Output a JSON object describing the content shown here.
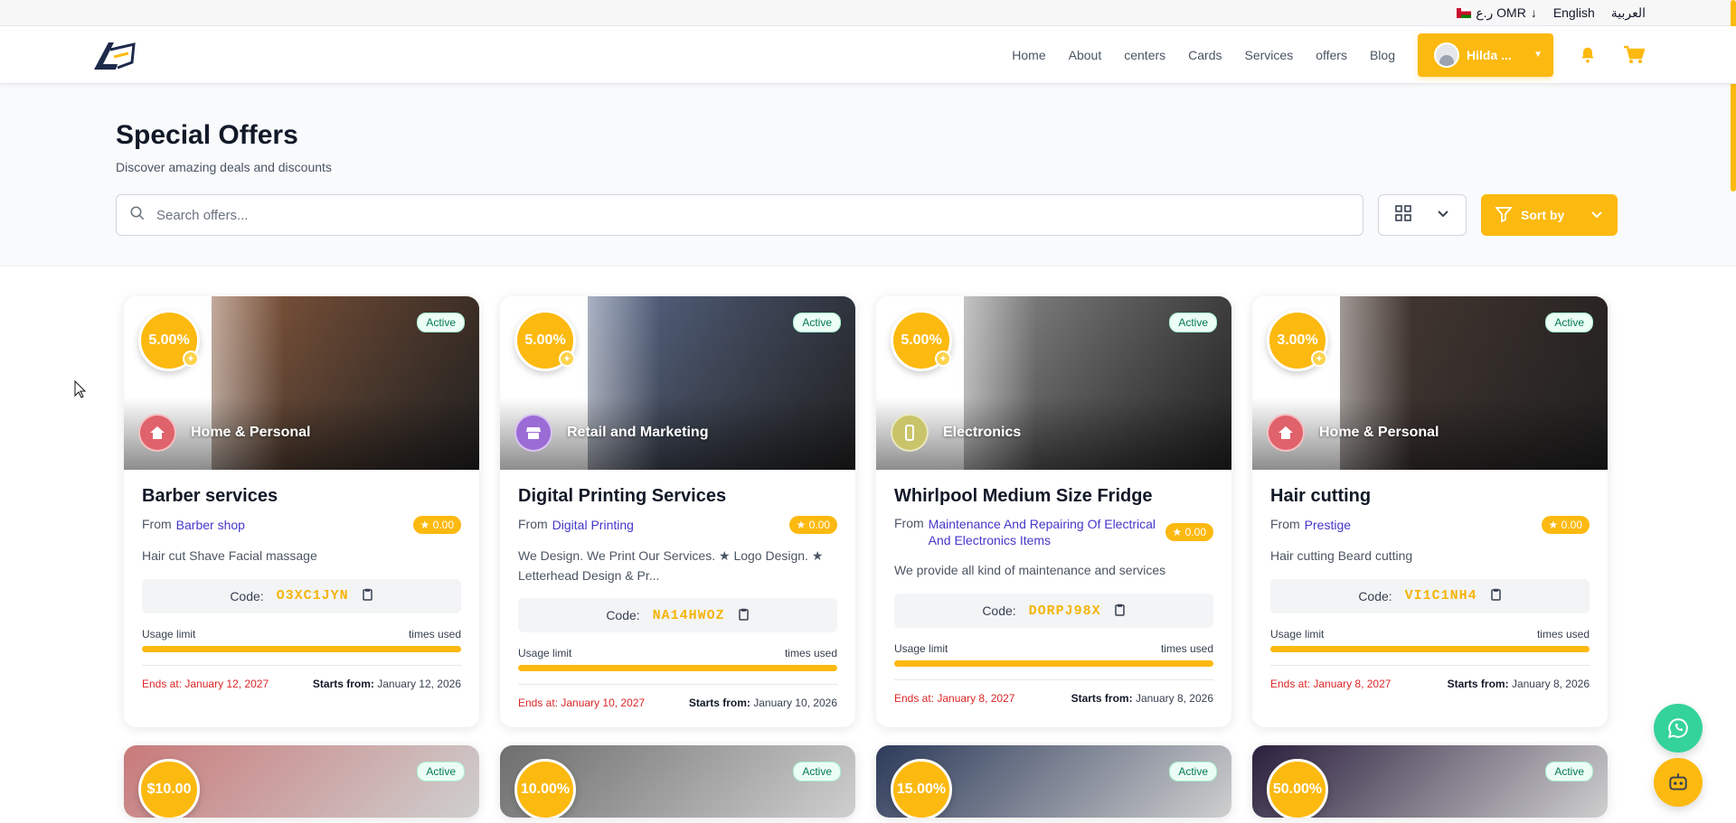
{
  "topbar": {
    "currency": "ر.ع OMR",
    "language_en": "English",
    "language_ar": "العربية"
  },
  "header": {
    "nav": [
      "Home",
      "About",
      "centers",
      "Cards",
      "Services",
      "offers",
      "Blog"
    ],
    "user_name": "Hilda ...",
    "accent": "#fcb90f"
  },
  "hero": {
    "title": "Special Offers",
    "subtitle": "Discover amazing deals and discounts",
    "search_placeholder": "Search offers...",
    "sort_label": "Sort by"
  },
  "offers": [
    {
      "discount": "5.00%",
      "status": "Active",
      "category": "Home & Personal",
      "category_icon": "home-icon",
      "title": "Barber services",
      "from_label": "From",
      "vendor": "Barber shop",
      "rating": "★ 0.00",
      "description": "Hair cut Shave Facial massage",
      "code_label": "Code:",
      "code": "O3XC1JYN",
      "usage_label": "Usage limit",
      "times_used_label": "times used",
      "ends_label": "Ends at:",
      "ends": "January 12, 2027",
      "starts_label": "Starts from:",
      "starts": "January 12, 2026",
      "photo_color": "#8a5a3c"
    },
    {
      "discount": "5.00%",
      "status": "Active",
      "category": "Retail and Marketing",
      "category_icon": "store-icon",
      "title": "Digital Printing Services",
      "from_label": "From",
      "vendor": "Digital Printing",
      "rating": "★ 0.00",
      "description": "We Design. We Print Our Services. ★ Logo Design. ★ Letterhead Design & Pr...",
      "code_label": "Code:",
      "code": "NA14HWOZ",
      "usage_label": "Usage limit",
      "times_used_label": "times used",
      "ends_label": "Ends at:",
      "ends": "January 10, 2027",
      "starts_label": "Starts from:",
      "starts": "January 10, 2026",
      "photo_color": "#5b6b8c"
    },
    {
      "discount": "5.00%",
      "status": "Active",
      "category": "Electronics",
      "category_icon": "phone-icon",
      "title": "Whirlpool Medium Size Fridge",
      "from_label": "From",
      "vendor": "Maintenance And Repairing Of Electrical And Electronics Items",
      "rating": "★ 0.00",
      "description": "We provide all kind of maintenance and services",
      "code_label": "Code:",
      "code": "DORPJ98X",
      "usage_label": "Usage limit",
      "times_used_label": "times used",
      "ends_label": "Ends at:",
      "ends": "January 8, 2027",
      "starts_label": "Starts from:",
      "starts": "January 8, 2026",
      "photo_color": "#8f8f8f"
    },
    {
      "discount": "3.00%",
      "status": "Active",
      "category": "Home & Personal",
      "category_icon": "home-icon",
      "title": "Hair cutting",
      "from_label": "From",
      "vendor": "Prestige",
      "rating": "★ 0.00",
      "description": "Hair cutting Beard cutting",
      "code_label": "Code:",
      "code": "VI1C1NH4",
      "usage_label": "Usage limit",
      "times_used_label": "times used",
      "ends_label": "Ends at:",
      "ends": "January 8, 2027",
      "starts_label": "Starts from:",
      "starts": "January 8, 2026",
      "photo_color": "#4a3a33"
    }
  ],
  "offers_row2": [
    {
      "discount": "$10.00",
      "status": "Active",
      "photo_color": "#c97a7a"
    },
    {
      "discount": "10.00%",
      "status": "Active",
      "photo_color": "#6e6e6e"
    },
    {
      "discount": "15.00%",
      "status": "Active",
      "photo_color": "#2d3b5a"
    },
    {
      "discount": "50.00%",
      "status": "Active",
      "photo_color": "#2a1f3d"
    }
  ]
}
